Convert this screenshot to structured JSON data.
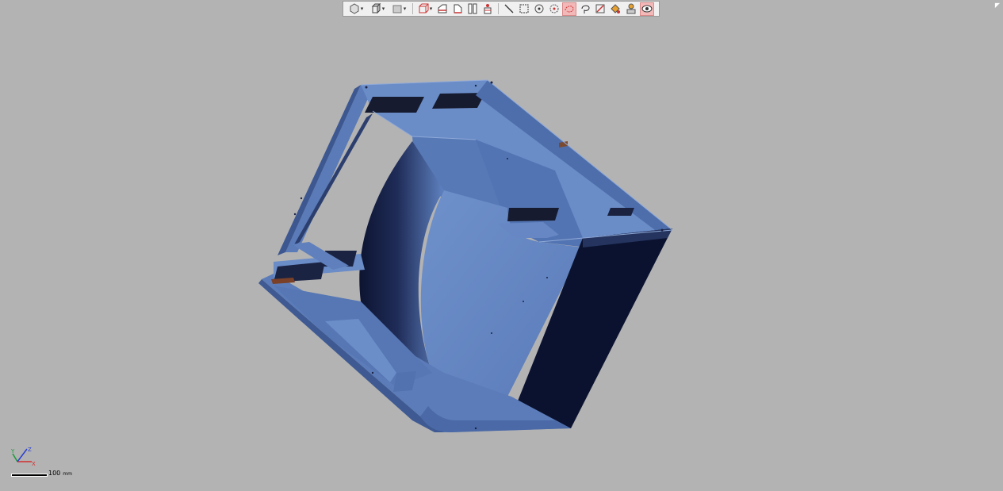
{
  "toolbar": {
    "items": [
      {
        "name": "select-shape-icon",
        "dropdown": true
      },
      {
        "name": "view-cube-icon",
        "dropdown": true
      },
      {
        "name": "display-mode-icon",
        "dropdown": true
      },
      {
        "name": "box-view-icon",
        "dropdown": true
      },
      {
        "name": "section-plane-icon"
      },
      {
        "name": "section-plane-2-icon"
      },
      {
        "name": "split-view-icon"
      },
      {
        "name": "person-section-icon"
      },
      {
        "name": "line-measure-icon"
      },
      {
        "name": "rectangle-select-icon"
      },
      {
        "name": "point-icon"
      },
      {
        "name": "circle-point-icon"
      },
      {
        "name": "freeform-select-icon",
        "active": true
      },
      {
        "name": "lasso-select-icon"
      },
      {
        "name": "pen-edit-icon"
      },
      {
        "name": "fill-select-icon"
      },
      {
        "name": "user-select-icon"
      },
      {
        "name": "visibility-eye-icon",
        "active": true
      }
    ]
  },
  "scale": {
    "value": "100",
    "unit": "mm"
  },
  "colors": {
    "background": "#b3b3b3",
    "model_light": "#6d8fc9",
    "model_mid": "#4c6aa6",
    "model_dark": "#0c1330",
    "active_tool": "#f3b9b9"
  }
}
